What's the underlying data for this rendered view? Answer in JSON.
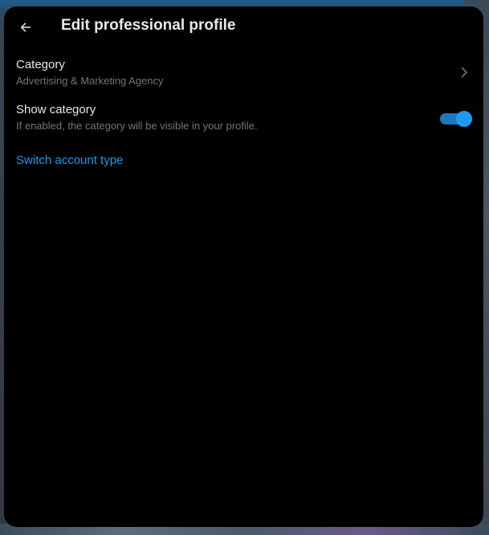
{
  "header": {
    "title": "Edit professional profile",
    "back_icon": "arrow-left-icon"
  },
  "category": {
    "label": "Category",
    "value": "Advertising & Marketing Agency",
    "chevron_icon": "chevron-right-icon"
  },
  "show_category": {
    "label": "Show category",
    "description": "If enabled, the category will be visible in your profile.",
    "enabled": true
  },
  "switch_account": {
    "label": "Switch account type"
  },
  "colors": {
    "background": "#000000",
    "text_primary": "#e7e9ea",
    "text_secondary": "#71767b",
    "accent": "#1d9bf0"
  }
}
